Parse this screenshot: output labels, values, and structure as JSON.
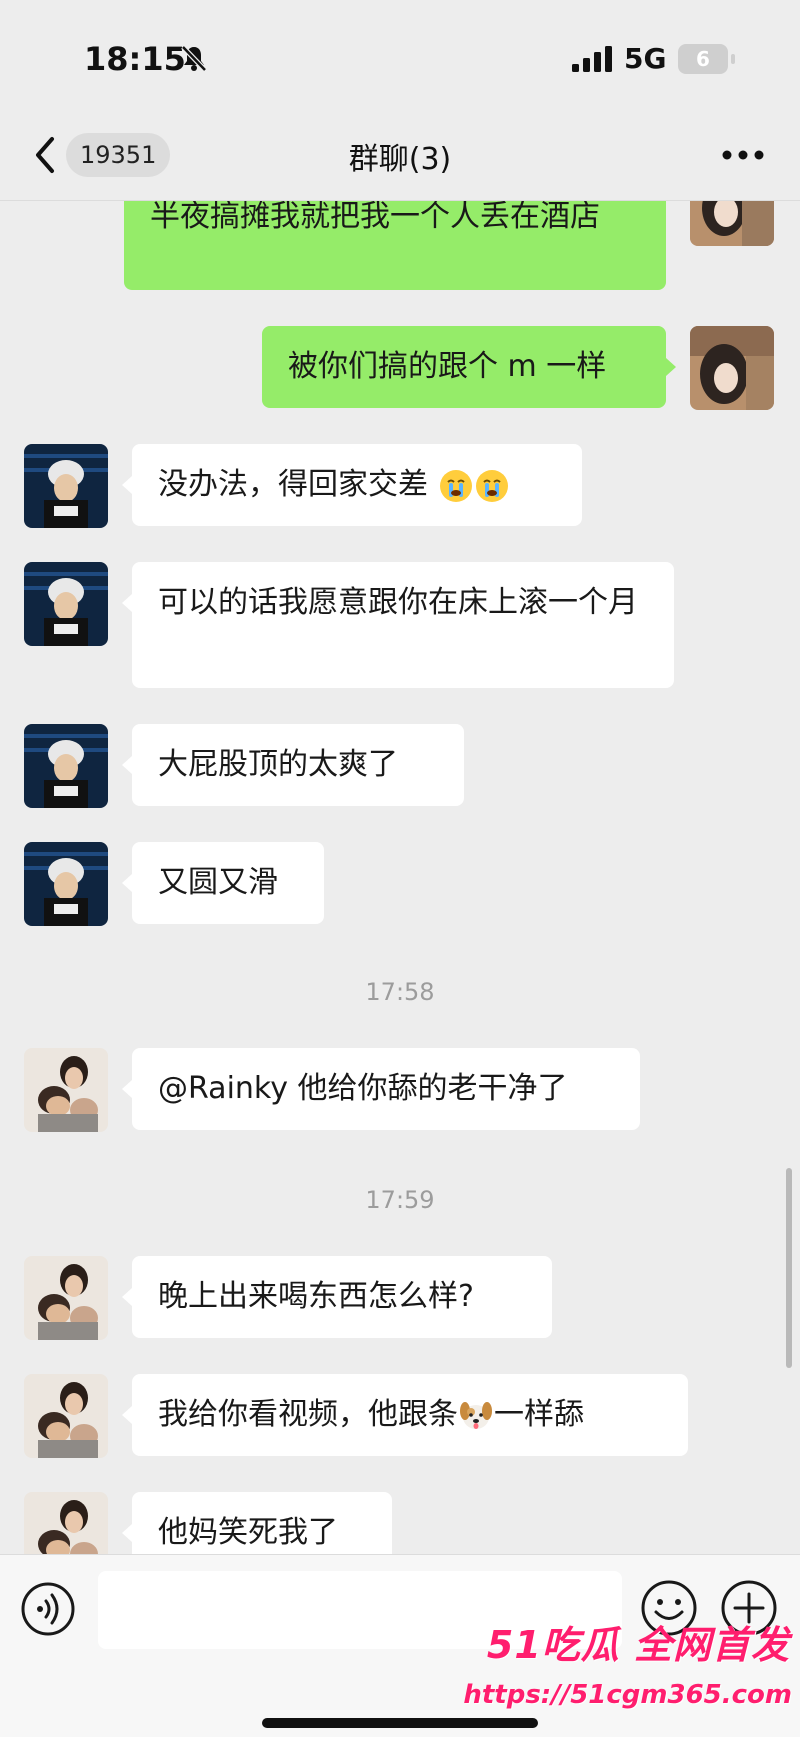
{
  "status_bar": {
    "time": "18:15",
    "network": "5G",
    "battery": "6"
  },
  "nav": {
    "unread_count": "19351",
    "title": "群聊(3)"
  },
  "messages": {
    "m1": "半夜搞摊我就把我一个人丢在酒店",
    "m2": "被你们搞的跟个 m 一样",
    "m3": "没办法，得回家交差",
    "m4": "可以的话我愿意跟你在床上滚一个月",
    "m5": "大屁股顶的太爽了",
    "m6": "又圆又滑",
    "t1": "17:58",
    "m7": "@Rainky 他给你舔的老干净了",
    "t2": "17:59",
    "m8": "晚上出来喝东西怎么样?",
    "m9a": "我给你看视频，他跟条",
    "m9b": "一样舔",
    "m10": "他妈笑死我了"
  },
  "icons": {
    "back": "chevron-left-icon",
    "more": "more-dots-icon",
    "voice": "voice-icon",
    "emoji": "emoji-icon",
    "plus": "plus-icon",
    "cry_emoji": "crying-face-emoji",
    "dog_emoji": "dog-face-emoji",
    "mute": "bell-slash-icon"
  },
  "colors": {
    "outgoing_bubble": "#95ec69",
    "incoming_bubble": "#ffffff",
    "background": "#ededed",
    "watermark": "#ff1e6e"
  },
  "input": {
    "value": ""
  },
  "watermark": {
    "main": "51吃瓜 全网首发",
    "url": "https://51cgm365.com"
  }
}
